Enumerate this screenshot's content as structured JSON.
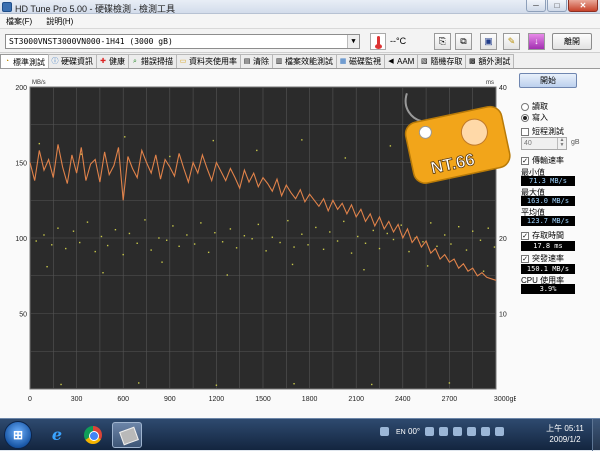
{
  "window": {
    "title": "HD Tune Pro  5.00 - 硬碟檢測 - 檢測工具",
    "btn_min": "─",
    "btn_max": "□",
    "btn_close": "✕"
  },
  "menu": [
    "檔案(F)",
    "說明(H)"
  ],
  "toolbar": {
    "drive": "ST3000VNST3000VN000-1H41 (3000 gB)",
    "temperature": "--°C",
    "exit_label": "離開",
    "buttons": [
      "copy-text-icon",
      "copy-screenshot-icon",
      "save-icon",
      "options-icon",
      "download-icon"
    ]
  },
  "tabs": [
    {
      "label": "標準測試",
      "icon": "benchmark-icon",
      "active": true
    },
    {
      "label": "硬碟資訊",
      "icon": "info-icon"
    },
    {
      "label": "健康",
      "icon": "health-icon"
    },
    {
      "label": "錯誤掃描",
      "icon": "scan-icon"
    },
    {
      "label": "資料夾使用率",
      "icon": "folder-icon"
    },
    {
      "label": "清除",
      "icon": "erase-icon"
    },
    {
      "label": "檔案效能測試",
      "icon": "file-icon"
    },
    {
      "label": "磁碟監視",
      "icon": "monitor-icon"
    },
    {
      "label": "AAM",
      "icon": "aam-icon"
    },
    {
      "label": "隨機存取",
      "icon": "random-icon"
    },
    {
      "label": "額外測試",
      "icon": "extra-icon"
    }
  ],
  "side": {
    "start_label": "開始",
    "read_label": "讀取",
    "write_label": "寫入",
    "short_test_label": "短程測試",
    "short_test_value": "40",
    "short_test_unit": "gB",
    "transfer_label": "傳輸速率",
    "min_label": "最小值",
    "min_value": "71.3 MB/s",
    "max_label": "最大值",
    "max_value": "163.0 MB/s",
    "avg_label": "平均值",
    "avg_value": "123.7 MB/s",
    "access_label": "存取時間",
    "access_value": "17.8 ms",
    "burst_label": "突發速率",
    "burst_value": "150.1 MB/s",
    "cpu_label": "CPU 使用率",
    "cpu_value": "3.9%"
  },
  "watermark": {
    "text": "NT.66"
  },
  "chart_data": {
    "type": "line",
    "xlabel": "gB",
    "ylabel_left": "MB/s",
    "ylabel_right": "ms",
    "xlim": [
      0,
      3000
    ],
    "ylim_left": [
      0,
      200
    ],
    "ylim_right": [
      0,
      40
    ],
    "x_ticks": [
      "0",
      "300",
      "600",
      "900",
      "1200",
      "1500",
      "1800",
      "2100",
      "2400",
      "2700",
      "3000gB"
    ],
    "y_ticks_left": [
      "200",
      "150",
      "100",
      "50"
    ],
    "y_ticks_right": [
      "40",
      "30",
      "20",
      "10"
    ],
    "grid": true,
    "colors": {
      "background": "#2b2b2b",
      "grid": "#555555",
      "transfer": "#e0824a",
      "access": "#c8c84a"
    },
    "series": [
      {
        "name": "傳輸速率",
        "axis": "left",
        "x": [
          0,
          30,
          60,
          90,
          120,
          150,
          180,
          210,
          240,
          270,
          300,
          330,
          360,
          390,
          420,
          450,
          480,
          510,
          540,
          570,
          600,
          630,
          660,
          690,
          720,
          750,
          780,
          810,
          840,
          870,
          900,
          930,
          960,
          990,
          1020,
          1050,
          1080,
          1110,
          1140,
          1170,
          1200,
          1230,
          1260,
          1290,
          1320,
          1350,
          1380,
          1410,
          1440,
          1470,
          1500,
          1530,
          1560,
          1590,
          1620,
          1650,
          1680,
          1710,
          1740,
          1770,
          1800,
          1830,
          1860,
          1890,
          1920,
          1950,
          1980,
          2010,
          2040,
          2070,
          2100,
          2130,
          2160,
          2190,
          2220,
          2250,
          2280,
          2310,
          2340,
          2370,
          2400,
          2430,
          2460,
          2490,
          2520,
          2550,
          2580,
          2610,
          2640,
          2670,
          2700,
          2730,
          2760,
          2790,
          2820,
          2850,
          2880,
          2910,
          2940,
          2970,
          3000
        ],
        "values": [
          150,
          138,
          158,
          145,
          152,
          140,
          162,
          147,
          136,
          155,
          143,
          160,
          138,
          149,
          152,
          137,
          157,
          142,
          148,
          160,
          125,
          154,
          146,
          140,
          158,
          150,
          143,
          155,
          139,
          152,
          147,
          141,
          156,
          146,
          137,
          150,
          143,
          155,
          146,
          138,
          150,
          144,
          138,
          146,
          140,
          133,
          145,
          137,
          143,
          134,
          140,
          136,
          131,
          139,
          128,
          135,
          130,
          126,
          132,
          124,
          129,
          125,
          121,
          126,
          118,
          125,
          119,
          123,
          116,
          122,
          114,
          119,
          111,
          116,
          108,
          114,
          106,
          111,
          104,
          109,
          100,
          106,
          97,
          101,
          94,
          98,
          90,
          93,
          86,
          89,
          84,
          86,
          80,
          83,
          78,
          80,
          75,
          77,
          74,
          73,
          72
        ]
      }
    ],
    "access_points": [
      [
        40,
        19.6
      ],
      [
        90,
        20.4
      ],
      [
        140,
        19.1
      ],
      [
        180,
        21.3
      ],
      [
        230,
        18.6
      ],
      [
        280,
        20.9
      ],
      [
        320,
        19.4
      ],
      [
        370,
        22.1
      ],
      [
        420,
        18.2
      ],
      [
        460,
        20.2
      ],
      [
        500,
        19.0
      ],
      [
        550,
        21.1
      ],
      [
        600,
        17.8
      ],
      [
        640,
        20.6
      ],
      [
        690,
        19.3
      ],
      [
        740,
        22.4
      ],
      [
        780,
        18.4
      ],
      [
        830,
        20.0
      ],
      [
        880,
        19.7
      ],
      [
        920,
        21.6
      ],
      [
        960,
        18.9
      ],
      [
        1010,
        20.4
      ],
      [
        1060,
        19.2
      ],
      [
        1100,
        22.0
      ],
      [
        1150,
        18.1
      ],
      [
        1190,
        20.7
      ],
      [
        1240,
        19.5
      ],
      [
        1290,
        21.2
      ],
      [
        1330,
        18.7
      ],
      [
        1380,
        20.3
      ],
      [
        1430,
        19.9
      ],
      [
        1470,
        21.8
      ],
      [
        1520,
        18.3
      ],
      [
        1560,
        20.1
      ],
      [
        1610,
        19.4
      ],
      [
        1660,
        22.3
      ],
      [
        1700,
        18.8
      ],
      [
        1750,
        20.5
      ],
      [
        1790,
        19.1
      ],
      [
        1840,
        21.4
      ],
      [
        1890,
        18.5
      ],
      [
        1930,
        20.8
      ],
      [
        1980,
        19.6
      ],
      [
        2020,
        22.2
      ],
      [
        2070,
        18.0
      ],
      [
        2110,
        20.2
      ],
      [
        2160,
        19.3
      ],
      [
        2210,
        21.0
      ],
      [
        2250,
        18.6
      ],
      [
        2300,
        20.6
      ],
      [
        2340,
        19.8
      ],
      [
        2390,
        21.7
      ],
      [
        2440,
        18.2
      ],
      [
        2480,
        20.0
      ],
      [
        2530,
        19.5
      ],
      [
        2580,
        22.0
      ],
      [
        2620,
        18.9
      ],
      [
        2670,
        20.4
      ],
      [
        2710,
        19.2
      ],
      [
        2760,
        21.5
      ],
      [
        2810,
        18.4
      ],
      [
        2850,
        20.9
      ],
      [
        2900,
        19.7
      ],
      [
        2950,
        21.3
      ],
      [
        2990,
        18.8
      ],
      [
        60,
        32.5
      ],
      [
        330,
        31.1
      ],
      [
        610,
        33.4
      ],
      [
        900,
        30.8
      ],
      [
        1180,
        32.9
      ],
      [
        1460,
        31.6
      ],
      [
        1750,
        33.0
      ],
      [
        2030,
        30.6
      ],
      [
        2320,
        32.2
      ],
      [
        2600,
        31.4
      ],
      [
        2880,
        32.7
      ],
      [
        110,
        16.2
      ],
      [
        470,
        15.4
      ],
      [
        850,
        16.8
      ],
      [
        1270,
        15.1
      ],
      [
        1690,
        16.5
      ],
      [
        2150,
        15.8
      ],
      [
        2560,
        16.3
      ],
      [
        2920,
        15.6
      ],
      [
        200,
        0.6
      ],
      [
        700,
        0.8
      ],
      [
        1200,
        0.5
      ],
      [
        1700,
        0.7
      ],
      [
        2200,
        0.6
      ],
      [
        2700,
        0.8
      ]
    ]
  },
  "taskbar": {
    "start_icon": "windows-orb-icon",
    "apps": [
      "ie-icon",
      "chrome-icon",
      "hdtune-icon"
    ],
    "tray_text": "00°",
    "lang": "EN",
    "ampm": "上午",
    "time": "05:11",
    "date": "2009/1/2"
  }
}
